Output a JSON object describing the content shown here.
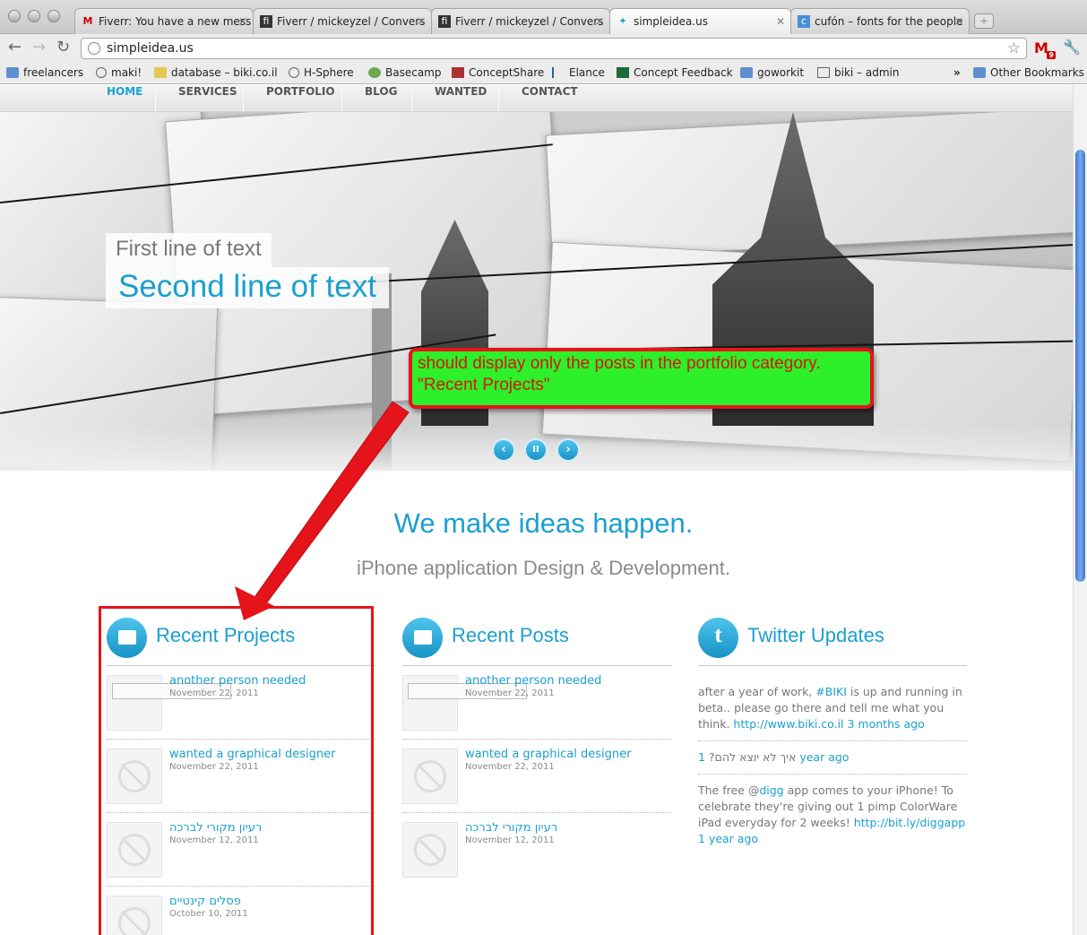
{
  "browser": {
    "tabs": [
      {
        "title": "Fiverr: You have a new mess",
        "icon": "gmail-icon"
      },
      {
        "title": "Fiverr / mickeyzel / Convers",
        "icon": "fiverr-icon"
      },
      {
        "title": "Fiverr / mickeyzel / Convers",
        "icon": "fiverr-icon"
      },
      {
        "title": "simpleidea.us",
        "icon": "bird-icon"
      },
      {
        "title": "cufón – fonts for the people",
        "icon": "cufon-icon"
      }
    ],
    "url": "simpleidea.us",
    "gmail_count": "9",
    "bookmarks": [
      {
        "label": "freelancers",
        "icon": "folder-icon"
      },
      {
        "label": "maki!",
        "icon": "globe-icon"
      },
      {
        "label": "database – biki.co.il",
        "icon": "pma-icon"
      },
      {
        "label": "H-Sphere",
        "icon": "globe-icon"
      },
      {
        "label": "Basecamp",
        "icon": "basecamp-icon"
      },
      {
        "label": "ConceptShare",
        "icon": "conceptshare-icon"
      },
      {
        "label": "Elance",
        "icon": "elance-icon"
      },
      {
        "label": "Concept Feedback",
        "icon": "cf-icon"
      },
      {
        "label": "goworkit",
        "icon": "folder-icon"
      },
      {
        "label": "biki – admin",
        "icon": "page-icon"
      }
    ],
    "more_bookmarks": "»",
    "other_bookmarks": "Other Bookmarks"
  },
  "site": {
    "nav": [
      "HOME",
      "SERVICES",
      "PORTFOLIO",
      "BLOG",
      "WANTED",
      "CONTACT"
    ],
    "hero": {
      "line1": "First line of text",
      "line2": "Second line of text",
      "controls": {
        "prev": "‹",
        "pause": "II",
        "next": "›"
      }
    },
    "tagline": "We make ideas happen.",
    "subtagline": "iPhone application Design & Development.",
    "recent_projects": {
      "title": "Recent Projects",
      "posts": [
        {
          "title": "another person needed",
          "date": "November 22, 2011"
        },
        {
          "title": "wanted a graphical designer",
          "date": "November 22, 2011"
        },
        {
          "title": "רעיון מקורי לברכה",
          "date": "November 12, 2011"
        },
        {
          "title": "פסלים קינטיים",
          "date": "October 10, 2011"
        }
      ]
    },
    "recent_posts": {
      "title": "Recent Posts",
      "posts": [
        {
          "title": "another person needed",
          "date": "November 22, 2011"
        },
        {
          "title": "wanted a graphical designer",
          "date": "November 22, 2011"
        },
        {
          "title": "רעיון מקורי לברכה",
          "date": "November 12, 2011"
        }
      ]
    },
    "twitter": {
      "title": "Twitter Updates",
      "tweets": [
        {
          "pre": "after a year of work, ",
          "tag": "#BIKI",
          "text": " is up and running in beta.. please go there and tell me what you think. ",
          "link": "http://www.biki.co.il",
          "time": "3 months ago"
        },
        {
          "pre": "",
          "tag": "1",
          "text": " איך לא יוצא להם? ",
          "link": "",
          "time": "year ago"
        },
        {
          "pre": "The free @",
          "tag": "digg",
          "text": " app comes to your iPhone! To celebrate they're giving out 1 pimp ColorWare iPad everyday for 2 weeks! ",
          "link": "http://bit.ly/diggapp",
          "time": "1 year ago"
        }
      ]
    }
  },
  "annotation": {
    "line1": "should display only the posts in the portfolio category.",
    "line2": "\"Recent Projects\""
  },
  "colors": {
    "accent": "#1a9fd0",
    "annotation_fill": "#2ef02a",
    "annotation_border": "#e5141a"
  }
}
